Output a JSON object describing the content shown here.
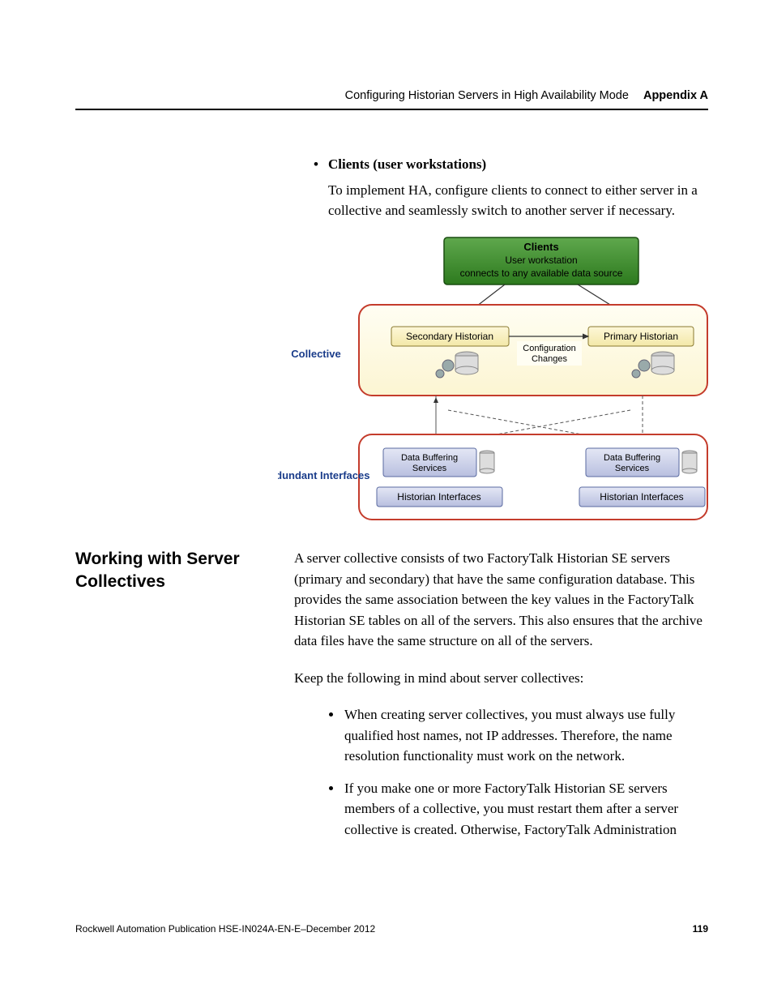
{
  "header": {
    "title": "Configuring Historian Servers in High Availability Mode",
    "appendix": "Appendix A"
  },
  "intro": {
    "bullet_title": "Clients (user workstations)",
    "bullet_body": "To implement HA, configure clients to connect to either server in a collective and seamlessly switch to another server if necessary."
  },
  "diagram": {
    "clients_title": "Clients",
    "clients_line1": "User workstation",
    "clients_line2": "connects to any available data source",
    "collective_label": "Collective",
    "secondary": "Secondary Historian",
    "primary": "Primary Historian",
    "config_changes": "Configuration\nChanges",
    "redundant_label": "Redundant Interfaces",
    "data_buffering": "Data Buffering\nServices",
    "historian_interfaces": "Historian Interfaces"
  },
  "section": {
    "heading": "Working with Server Collectives",
    "para1": "A server collective consists of two FactoryTalk Historian SE servers (primary and secondary) that have the same configuration database. This provides the same association between the key values in the FactoryTalk Historian SE tables on all of the servers. This also ensures that the archive data files have the same structure on all of the servers.",
    "para2": "Keep the following in mind about server collectives:",
    "bullets": [
      "When creating server collectives, you must always use fully qualified host names, not IP addresses. Therefore, the name resolution functionality must work on the network.",
      "If you make one or more FactoryTalk Historian SE servers members of a collective, you must restart them after a server collective is created. Otherwise, FactoryTalk Administration"
    ]
  },
  "footer": {
    "pub": "Rockwell Automation Publication HSE-IN024A-EN-E–December 2012",
    "page": "119"
  }
}
